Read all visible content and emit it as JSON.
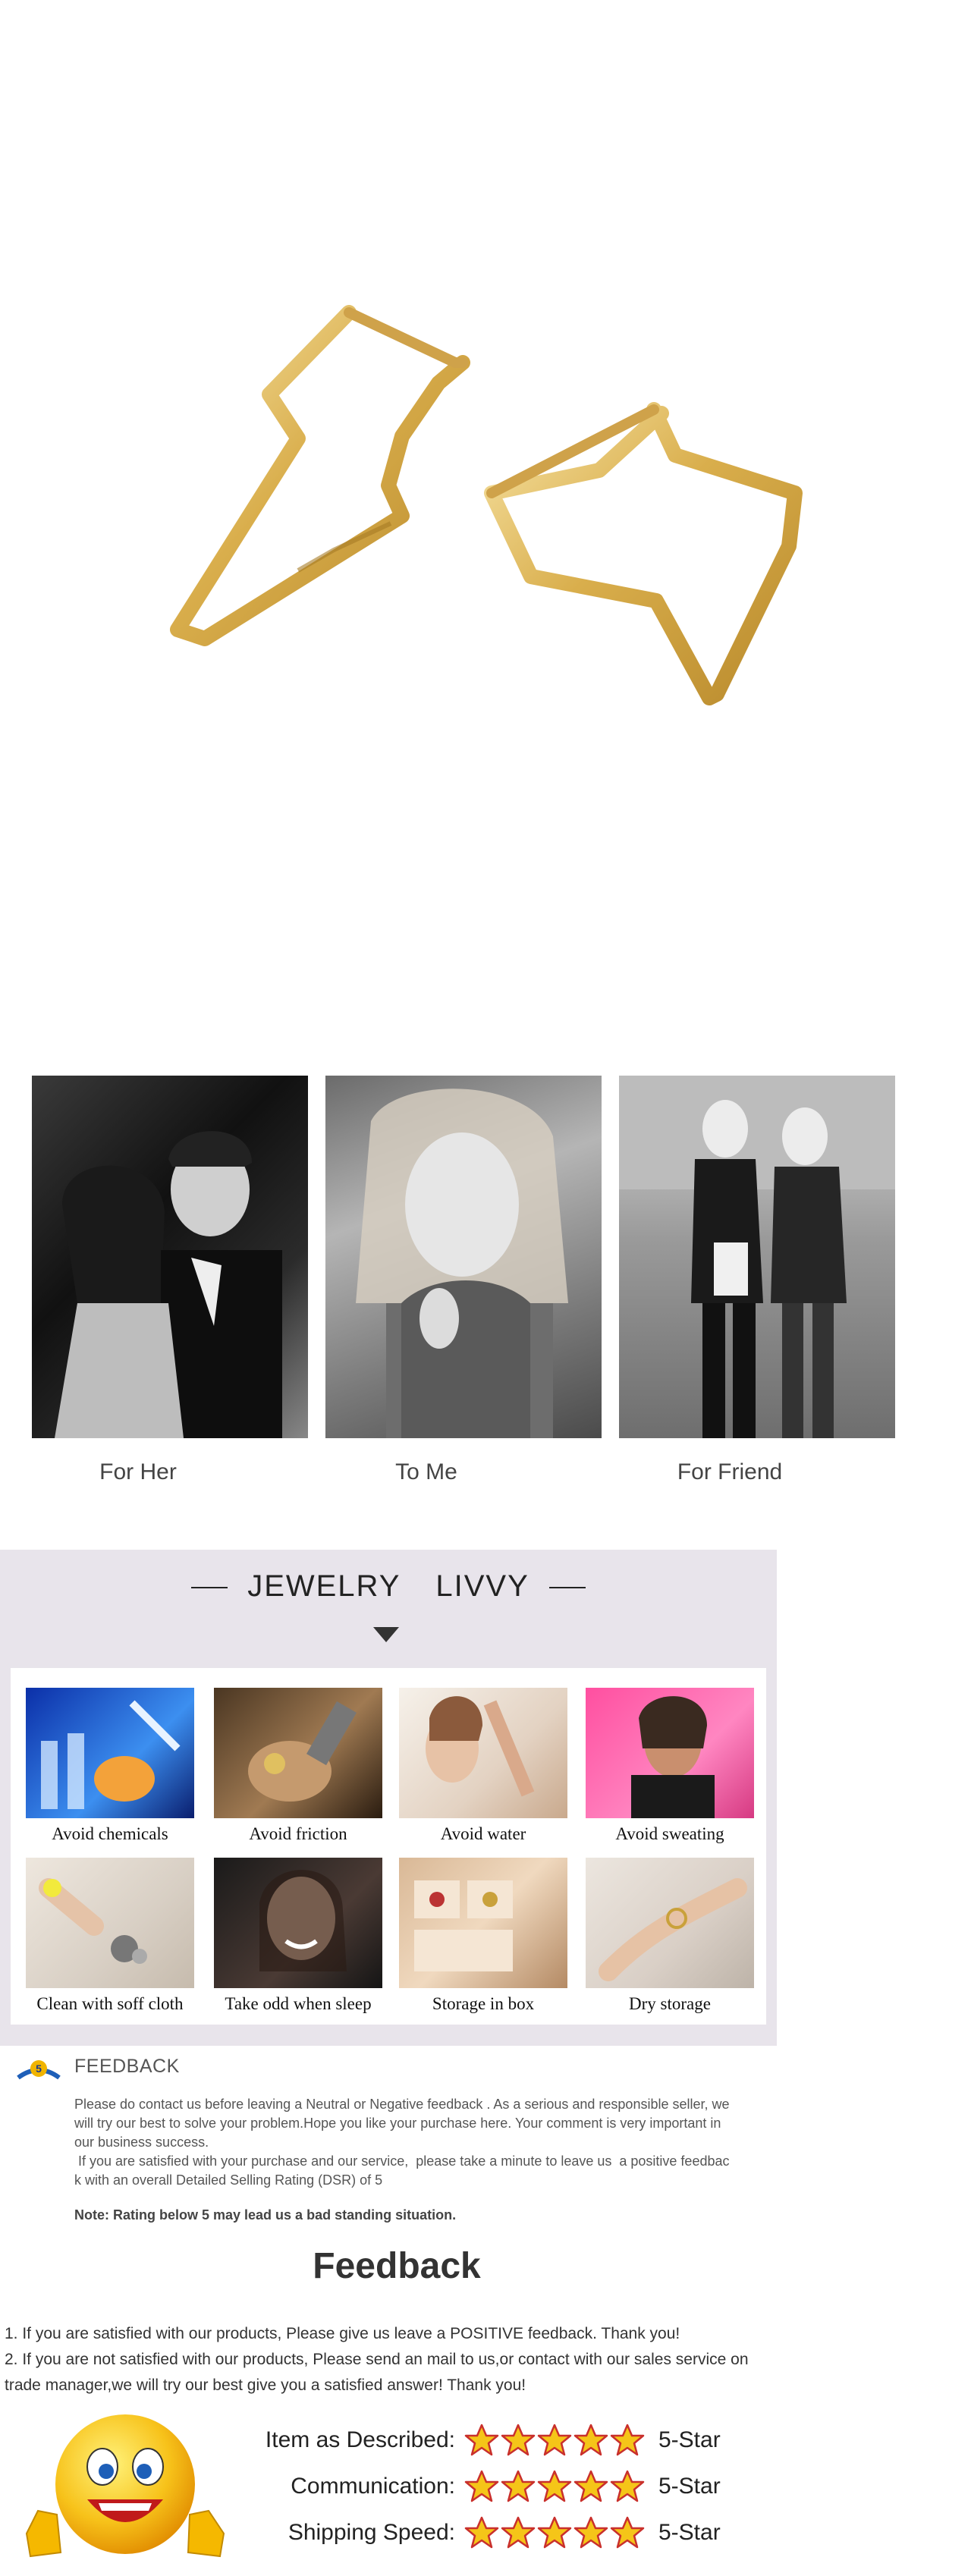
{
  "hero": {
    "product": "gold-hoop-earrings-image"
  },
  "gallery": {
    "items": [
      {
        "caption": "For Her",
        "image": "couple-photo"
      },
      {
        "caption": "To Me",
        "image": "woman-portrait-photo"
      },
      {
        "caption": "For Friend",
        "image": "friends-walking-photo"
      }
    ]
  },
  "care": {
    "title_left": "JEWELRY",
    "title_right": "LIVVY",
    "items": [
      {
        "label": "Avoid chemicals",
        "icon": "chemicals-photo"
      },
      {
        "label": "Avoid friction",
        "icon": "friction-photo"
      },
      {
        "label": "Avoid water",
        "icon": "water-photo"
      },
      {
        "label": "Avoid sweating",
        "icon": "sweating-photo"
      },
      {
        "label": "Clean with soff cloth",
        "icon": "cloth-photo"
      },
      {
        "label": "Take odd when sleep",
        "icon": "sleep-photo"
      },
      {
        "label": "Storage in box",
        "icon": "box-photo"
      },
      {
        "label": "Dry storage",
        "icon": "dry-photo"
      }
    ]
  },
  "feedback_notice": {
    "title": "FEEDBACK",
    "paragraph1_line1": "Please do contact us before leaving a Neutral or Negative  feedback . As a serious and responsible seller, we",
    "paragraph1_line2": "will try our best to solve your problem.Hope you like your purchase here. Your comment is very important in",
    "paragraph1_line3": "our business success.",
    "paragraph2_line1": " If you are satisfied with your purchase and our service,  please take a minute to leave us  a positive feedbac",
    "paragraph2_line2": "k with an overall  Detailed Selling Rating (DSR) of 5",
    "note": "Note: Rating below 5 may lead us a bad standing situation."
  },
  "feedback": {
    "heading": "Feedback",
    "line1": "1. If you are satisfied with our products, Please give us leave a POSITIVE feedback. Thank you!",
    "line2": "2. If you are not satisfied with our products, Please send an mail to us,or contact with our sales service on",
    "line3": "trade manager,we will try our best give you a satisfied answer! Thank you!"
  },
  "ratings": [
    {
      "label": "Item as Described:",
      "stars": 5,
      "value": "5-Star"
    },
    {
      "label": "Communication:",
      "stars": 5,
      "value": "5-Star"
    },
    {
      "label": "Shipping Speed:",
      "stars": 5,
      "value": "5-Star"
    }
  ],
  "colors": {
    "gold": "#e3c06a",
    "star_fill": "#f5c518",
    "star_stroke": "#c9302c",
    "panel_bg": "#e8e4eb"
  }
}
